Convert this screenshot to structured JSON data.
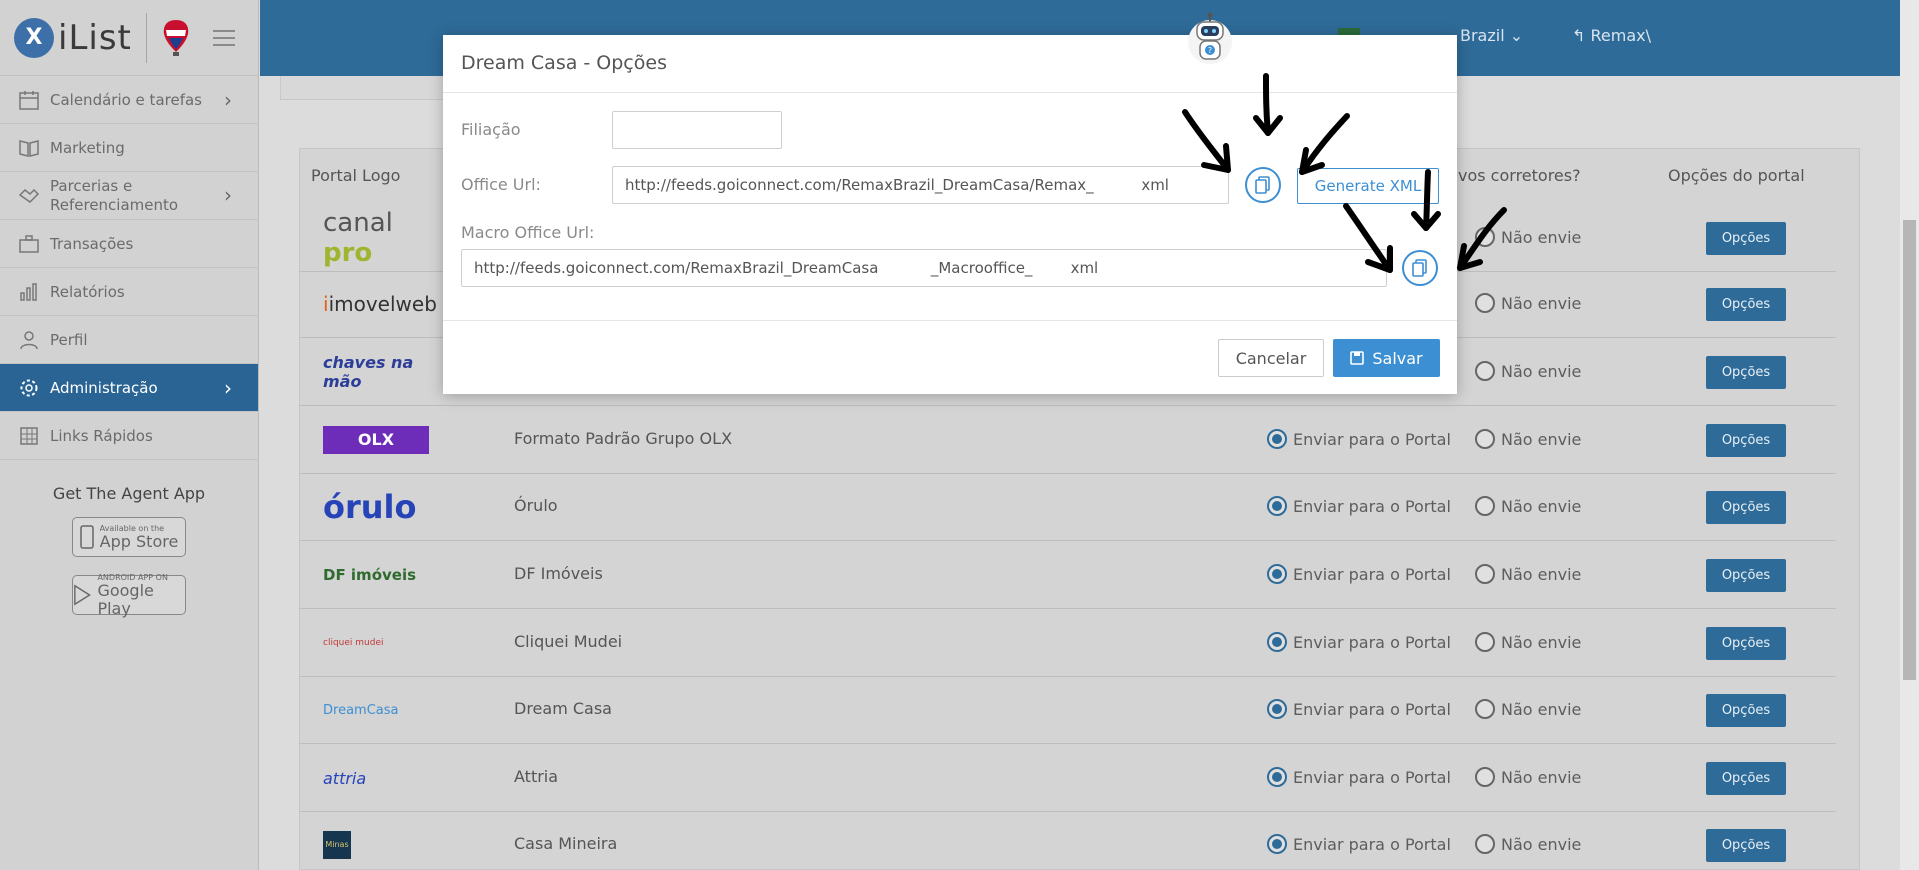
{
  "logo": {
    "text": "iList",
    "mark": "X"
  },
  "sidebar": {
    "items": [
      {
        "label": "Calendário e tarefas",
        "icon": "calendar-icon",
        "chevron": true
      },
      {
        "label": "Marketing",
        "icon": "book-icon",
        "chevron": false
      },
      {
        "label": "Parcerias e Referenciamento",
        "icon": "handshake-icon",
        "chevron": true
      },
      {
        "label": "Transações",
        "icon": "briefcase-icon",
        "chevron": false
      },
      {
        "label": "Relatórios",
        "icon": "bar-chart-icon",
        "chevron": false
      },
      {
        "label": "Perfil",
        "icon": "user-icon",
        "chevron": false
      },
      {
        "label": "Administração",
        "icon": "gear-icon",
        "chevron": true,
        "active": true
      },
      {
        "label": "Links Rápidos",
        "icon": "grid-icon",
        "chevron": false
      }
    ],
    "agent_app": "Get The Agent App",
    "app_store": {
      "small": "Available on the",
      "big": "App Store"
    },
    "google_play": {
      "small": "ANDROID APP ON",
      "big": "Google Play"
    }
  },
  "header": {
    "country": "Brazil",
    "account": "Remax\\"
  },
  "table": {
    "headers": {
      "logo": "Portal Logo",
      "send": "vos corretores?",
      "options": "Opções do portal"
    },
    "send_label": "Enviar para o Portal",
    "no_send_label": "Não envie",
    "options_label": "Opções",
    "rows": [
      {
        "logo": "canal pro",
        "name": "",
        "sent": false
      },
      {
        "logo": "imovelweb",
        "name": "",
        "sent": false
      },
      {
        "logo": "chaves na mão",
        "name": "",
        "sent": false
      },
      {
        "logo": "OLX",
        "name": "Formato Padrão Grupo OLX",
        "sent": true
      },
      {
        "logo": "órulo",
        "name": "Órulo",
        "sent": true
      },
      {
        "logo": "DF imóveis",
        "name": "DF Imóveis",
        "sent": true
      },
      {
        "logo": "cliquei mudei",
        "name": "Cliquei Mudei",
        "sent": true
      },
      {
        "logo": "DreamCasa",
        "name": "Dream Casa",
        "sent": true
      },
      {
        "logo": "attria",
        "name": "Attria",
        "sent": true
      },
      {
        "logo": "Minas",
        "name": "Casa Mineira",
        "sent": true
      }
    ]
  },
  "modal": {
    "title": "Dream Casa - Opções",
    "filiacao_label": "Filiação",
    "filiacao_value": "",
    "office_url_label": "Office Url:",
    "office_url_value": "http://feeds.goiconnect.com/RemaxBrazil_DreamCasa/Remax_          xml",
    "macro_url_label": "Macro Office Url:",
    "macro_url_value": "http://feeds.goiconnect.com/RemaxBrazil_DreamCasa           _Macrooffice_        xml",
    "generate_label": "Generate XML",
    "cancel_label": "Cancelar",
    "save_label": "Salvar"
  }
}
